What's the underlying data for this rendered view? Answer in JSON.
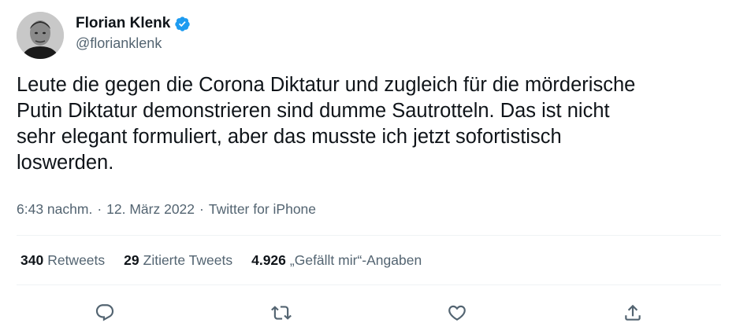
{
  "author": {
    "display_name": "Florian Klenk",
    "handle": "@florianklenk",
    "verified": true
  },
  "tweet": {
    "text_lines": [
      "Leute die gegen die Corona Diktatur und zugleich für die mörderische",
      "Putin Diktatur demonstrieren sind dumme Sautrotteln. Das ist nicht",
      "sehr elegant formuliert, aber das musste ich jetzt sofortistisch",
      "loswerden."
    ],
    "time": "6:43 nachm.",
    "separator": "·",
    "date": "12. März 2022",
    "source": "Twitter for iPhone"
  },
  "stats": {
    "retweets": {
      "count": "340",
      "label": "Retweets"
    },
    "quotes": {
      "count": "29",
      "label": "Zitierte Tweets"
    },
    "likes": {
      "count": "4.926",
      "label": "„Gefällt mir“-Angaben"
    }
  },
  "actions": [
    {
      "name": "reply",
      "icon": "reply-icon"
    },
    {
      "name": "retweet",
      "icon": "retweet-icon"
    },
    {
      "name": "like",
      "icon": "heart-icon"
    },
    {
      "name": "share",
      "icon": "share-icon"
    }
  ],
  "colors": {
    "text_primary": "#0f1419",
    "text_secondary": "#536471",
    "verified_blue": "#1d9bf0",
    "divider": "#eff3f4"
  }
}
